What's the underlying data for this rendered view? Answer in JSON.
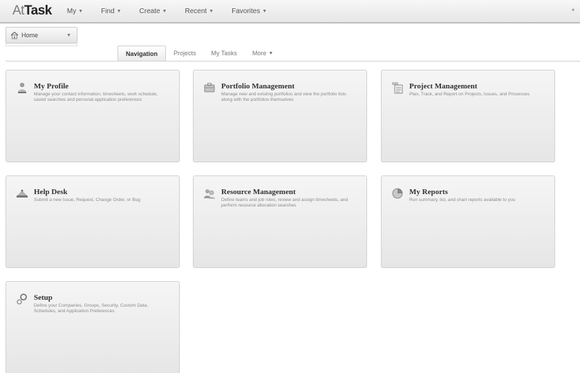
{
  "brand": {
    "logo_mark": "At",
    "logo_rest": "Task"
  },
  "topnav": [
    {
      "label": "My"
    },
    {
      "label": "Find"
    },
    {
      "label": "Create"
    },
    {
      "label": "Recent"
    },
    {
      "label": "Favorites"
    }
  ],
  "topbar_right": "▾",
  "home_button": {
    "label": "Home"
  },
  "tabs": [
    {
      "label": "Navigation"
    },
    {
      "label": "Projects"
    },
    {
      "label": "My Tasks"
    },
    {
      "label": "More"
    }
  ],
  "tiles": [
    {
      "title": "My Profile",
      "icon": "profile-icon",
      "desc": "Manage your contact information, timesheets, work schedule, saved searches and personal application preferences"
    },
    {
      "title": "Portfolio Management",
      "icon": "portfolio-icon",
      "desc": "Manage new and existing portfolios and view the portfolio lists along with the portfolios themselves"
    },
    {
      "title": "Project Management",
      "icon": "project-icon",
      "desc": "Plan, Track, and Report on Projects, Issues, and Processes"
    },
    {
      "title": "Help Desk",
      "icon": "help-desk-icon",
      "desc": "Submit a new Issue, Request, Change Order, or Bug"
    },
    {
      "title": "Resource Management",
      "icon": "resource-icon",
      "desc": "Define teams and job roles, review and assign timesheets, and perform resource allocation searches"
    },
    {
      "title": "My Reports",
      "icon": "reports-icon",
      "desc": "Run summary, list, and chart reports available to you"
    },
    {
      "title": "Setup",
      "icon": "setup-icon",
      "desc": "Define your Companies, Groups, Security, Custom Data, Schedules, and Application Preferences"
    }
  ],
  "colors": {
    "accent": "#bdbdbd",
    "tile_bg": "#eeeeee",
    "text": "#333333"
  }
}
